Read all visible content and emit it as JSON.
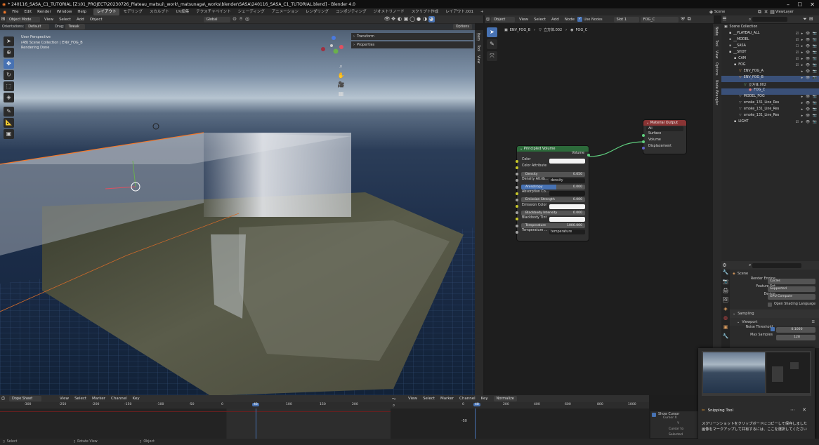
{
  "window": {
    "title": "* 240116_SASA_C1_TUTORIAL [Z:\\01_PROJECT\\20230726_Plateau_matsui\\_work\\_matsunaga\\_works\\blender\\SASA\\240116_SASA_C1_TUTORIAL.blend] - Blender 4.0"
  },
  "menu": {
    "items": [
      "File",
      "Edit",
      "Render",
      "Window",
      "Help"
    ]
  },
  "workspaces": {
    "tabs": [
      "レイアウト",
      "モデリング",
      "スカルプト",
      "UV編集",
      "テクスチャペイント",
      "シェーディング",
      "アニメーション",
      "レンダリング",
      "コンポジティング",
      "ジオメトリノード",
      "スクリプト作成",
      "レイアウト.001"
    ],
    "active": "レイアウト",
    "add": "+"
  },
  "topright": {
    "scene": "Scene",
    "viewlayer": "ViewLayer"
  },
  "viewport_header": {
    "mode": "Object Mode",
    "menus": [
      "View",
      "Select",
      "Add",
      "Object"
    ],
    "orientation_label": "Orientations:",
    "orientation": "Default",
    "drag_label": "Drag:",
    "drag": "Tweak",
    "transform": "Global",
    "options": "Options"
  },
  "viewport": {
    "overlay_line1": "User Perspective",
    "overlay_line2": "(48) Scene Collection | ENV_FOG_B",
    "overlay_line3": "Rendering Done",
    "panel_transform": "Transform",
    "panel_properties": "Properties",
    "side_tabs": [
      "Item",
      "Tool",
      "View"
    ],
    "gizmo_axes": [
      "X",
      "Y",
      "Z"
    ]
  },
  "node_header": {
    "type": "Object",
    "menus": [
      "View",
      "Select",
      "Add",
      "Node"
    ],
    "use_nodes": "Use Nodes",
    "slot": "Slot 1",
    "material": "FOG_C"
  },
  "breadcrumb": {
    "items": [
      "ENV_FOG_B",
      "立方体.002",
      "FOG_C"
    ]
  },
  "node_side_tabs": [
    "Node",
    "Tool",
    "View",
    "Options",
    "Node Wrangler"
  ],
  "material_output": {
    "title": "Material Output",
    "target": "All",
    "inputs": [
      "Surface",
      "Volume",
      "Displacement"
    ]
  },
  "principled_volume": {
    "title": "Principled Volume",
    "output": "Volume",
    "rows": [
      {
        "label": "Color",
        "kind": "color",
        "value": ""
      },
      {
        "label": "Color Attribute",
        "kind": "label",
        "value": ""
      },
      {
        "label": "Density",
        "kind": "field",
        "value": "0.050"
      },
      {
        "label": "Density Attrib...",
        "kind": "text",
        "value": "density"
      },
      {
        "label": "Anisotropy",
        "kind": "slider",
        "value": "0.000"
      },
      {
        "label": "Absorption Co...",
        "kind": "dark",
        "value": ""
      },
      {
        "label": "Emission Strength",
        "kind": "field",
        "value": "0.000"
      },
      {
        "label": "Emission Color",
        "kind": "color",
        "value": ""
      },
      {
        "label": "Blackbody Intensity",
        "kind": "field",
        "value": "0.000"
      },
      {
        "label": "Blackbody Tint",
        "kind": "color",
        "value": ""
      },
      {
        "label": "Temperature",
        "kind": "field",
        "value": "1000.000"
      },
      {
        "label": "Temperature ...",
        "kind": "text",
        "value": "temperature"
      }
    ]
  },
  "outliner": {
    "rows": [
      {
        "name": "Scene Collection",
        "indent": 0,
        "icon": "▣",
        "color": "#cfcfcf",
        "selected": false,
        "icons": ""
      },
      {
        "name": "__PLATEAU_ALL",
        "indent": 1,
        "icon": "▪",
        "color": "#cfcfcf",
        "selected": false,
        "icons": "☑ ▸ 👁 📷"
      },
      {
        "name": "__MODEL",
        "indent": 1,
        "icon": "▪",
        "color": "#9a9a9a",
        "selected": false,
        "icons": "☑ ▸ 👁 📷"
      },
      {
        "name": "__SASA",
        "indent": 1,
        "icon": "▪",
        "color": "#9a9a9a",
        "selected": false,
        "icons": "☐ ▸ 👁 📷"
      },
      {
        "name": "__SHOT",
        "indent": 1,
        "icon": "▪",
        "color": "#cfcfcf",
        "selected": false,
        "icons": "☑ ▸ 👁 📷"
      },
      {
        "name": "CAM",
        "indent": 2,
        "icon": "▪",
        "color": "#cfcfcf",
        "selected": false,
        "icons": "☑ ▸ 👁 📷"
      },
      {
        "name": "FOG",
        "indent": 2,
        "icon": "▪",
        "color": "#cfcfcf",
        "selected": false,
        "icons": "☑ ▸ 👁 📷"
      },
      {
        "name": "ENV_FOG_A",
        "indent": 3,
        "icon": "▽",
        "color": "#e0a060",
        "selected": false,
        "icons": "▸ 👁 📷"
      },
      {
        "name": "ENV_FOG_B",
        "indent": 3,
        "icon": "▽",
        "color": "#e0a060",
        "selected": true,
        "icons": "▸ 👁 📷"
      },
      {
        "name": "立方体.002",
        "indent": 4,
        "icon": "▽",
        "color": "#7ec77e",
        "selected": false,
        "icons": ""
      },
      {
        "name": "FOG_C",
        "indent": 5,
        "icon": "●",
        "color": "#e07a7a",
        "selected": true,
        "icons": ""
      },
      {
        "name": "MODEL_FOG",
        "indent": 3,
        "icon": "▽",
        "color": "#9a9a9a",
        "selected": false,
        "icons": "▸ 👁 📷"
      },
      {
        "name": "smoke_131_Line_Res",
        "indent": 3,
        "icon": "▽",
        "color": "#9a9a9a",
        "selected": false,
        "icons": "▸ 👁 📷"
      },
      {
        "name": "smoke_131_Line_Res",
        "indent": 3,
        "icon": "▽",
        "color": "#9a9a9a",
        "selected": false,
        "icons": "▸ 👁 📷"
      },
      {
        "name": "smoke_131_Line_Res",
        "indent": 3,
        "icon": "▽",
        "color": "#9a9a9a",
        "selected": false,
        "icons": "▸ 👁 📷"
      },
      {
        "name": "LIGHT",
        "indent": 2,
        "icon": "▪",
        "color": "#cfcfcf",
        "selected": false,
        "icons": "☑ ▸ 👁 📷"
      }
    ]
  },
  "properties": {
    "context": "Scene",
    "render_engine_label": "Render Engine",
    "render_engine": "Cycles",
    "feature_set_label": "Feature Set",
    "feature_set": "Supported",
    "device_label": "Device",
    "device": "GPU Compute",
    "osl_label": "Open Shading Language",
    "sampling": "Sampling",
    "viewport": "Viewport",
    "noise_threshold_label": "Noise Threshold",
    "noise_threshold": "0.1000",
    "max_samples_label": "Max Samples",
    "max_samples": "128"
  },
  "dopesheet": {
    "mode": "Dope Sheet",
    "menus": [
      "View",
      "Select",
      "Marker",
      "Channel",
      "Key"
    ],
    "ticks": [
      "-300",
      "-250",
      "-200",
      "-150",
      "-100",
      "-50",
      "0",
      "48",
      "100",
      "150",
      "200"
    ],
    "current": "48"
  },
  "graph": {
    "menus": [
      "View",
      "Select",
      "Marker",
      "Channel",
      "Key"
    ],
    "normalize": "Normalize",
    "ticks": [
      "0",
      "48",
      "200",
      "400",
      "600",
      "800",
      "1000"
    ],
    "ylabel": "-50",
    "show_cursor": "Show Cursor",
    "cursor_x": "Cursor X",
    "cursor_y": "Y",
    "cursor_to_selected": "Cursor to Selected"
  },
  "snip": {
    "title": "Snipping Tool",
    "line1": "スクリーンショットをクリップボードにコピーして保存しました",
    "line2": "画像をマークアップして共有するには、ここを選択してください"
  },
  "status": {
    "select": "Select",
    "rotate": "Rotate View",
    "object": "Object"
  }
}
